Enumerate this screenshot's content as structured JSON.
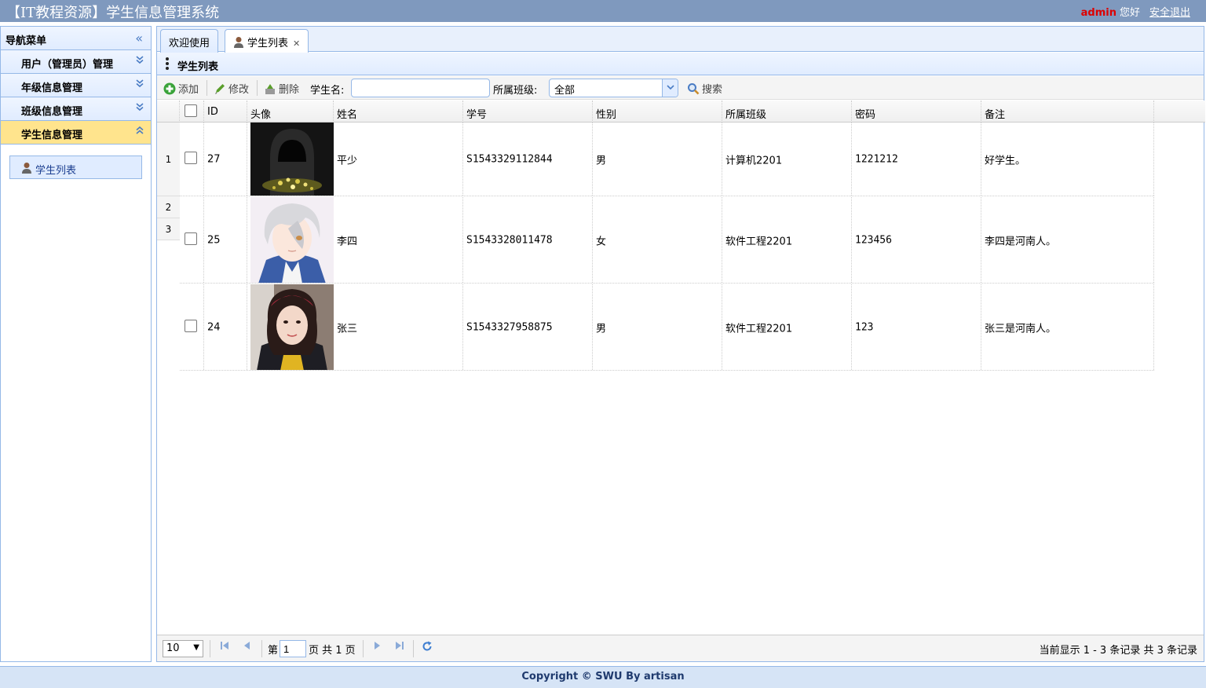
{
  "header": {
    "title": "【IT教程资源】学生信息管理系统",
    "username": "admin",
    "greeting": "您好",
    "logout": "安全退出"
  },
  "sidebar": {
    "title": "导航菜单",
    "collapse_icon": "double-chevron-left-icon",
    "items": [
      {
        "label": "用户（管理员）管理",
        "state": "collapsed"
      },
      {
        "label": "年级信息管理",
        "state": "collapsed"
      },
      {
        "label": "班级信息管理",
        "state": "collapsed"
      },
      {
        "label": "学生信息管理",
        "state": "expanded"
      }
    ],
    "sub_items": [
      {
        "label": "学生列表",
        "icon": "user-icon"
      }
    ]
  },
  "tabs": [
    {
      "label": "欢迎使用",
      "active": false
    },
    {
      "label": "学生列表",
      "active": true,
      "closable": true
    }
  ],
  "panel": {
    "title": "学生列表"
  },
  "toolbar": {
    "add_label": "添加",
    "edit_label": "修改",
    "delete_label": "删除",
    "name_label": "学生名:",
    "name_value": "",
    "class_label": "所属班级:",
    "class_value": "全部",
    "search_label": "搜索"
  },
  "table": {
    "columns": [
      "ID",
      "头像",
      "姓名",
      "学号",
      "性别",
      "所属班级",
      "密码",
      "备注"
    ],
    "rows": [
      {
        "num": "1",
        "id": "27",
        "avatar": "hooded-figure",
        "name": "平少",
        "sno": "S1543329112844",
        "gender": "男",
        "class": "计算机2201",
        "password": "1221212",
        "note": "好学生。"
      },
      {
        "num": "2",
        "id": "25",
        "avatar": "anime-boy",
        "name": "李四",
        "sno": "S1543328011478",
        "gender": "女",
        "class": "软件工程2201",
        "password": "123456",
        "note": "李四是河南人。"
      },
      {
        "num": "3",
        "id": "24",
        "avatar": "girl-photo",
        "name": "张三",
        "sno": "S1543327958875",
        "gender": "男",
        "class": "软件工程2201",
        "password": "123",
        "note": "张三是河南人。"
      }
    ]
  },
  "pager": {
    "page_size": "10",
    "page_prefix": "第",
    "page_value": "1",
    "page_suffix": "页 共 1 页",
    "info": "当前显示 1 - 3 条记录 共 3 条记录"
  },
  "footer": {
    "text": "Copyright © SWU By artisan"
  },
  "colors": {
    "header_bg": "#7f99be",
    "border": "#95b8e7",
    "active_menu": "#ffe48d",
    "username": "#dd0000"
  }
}
